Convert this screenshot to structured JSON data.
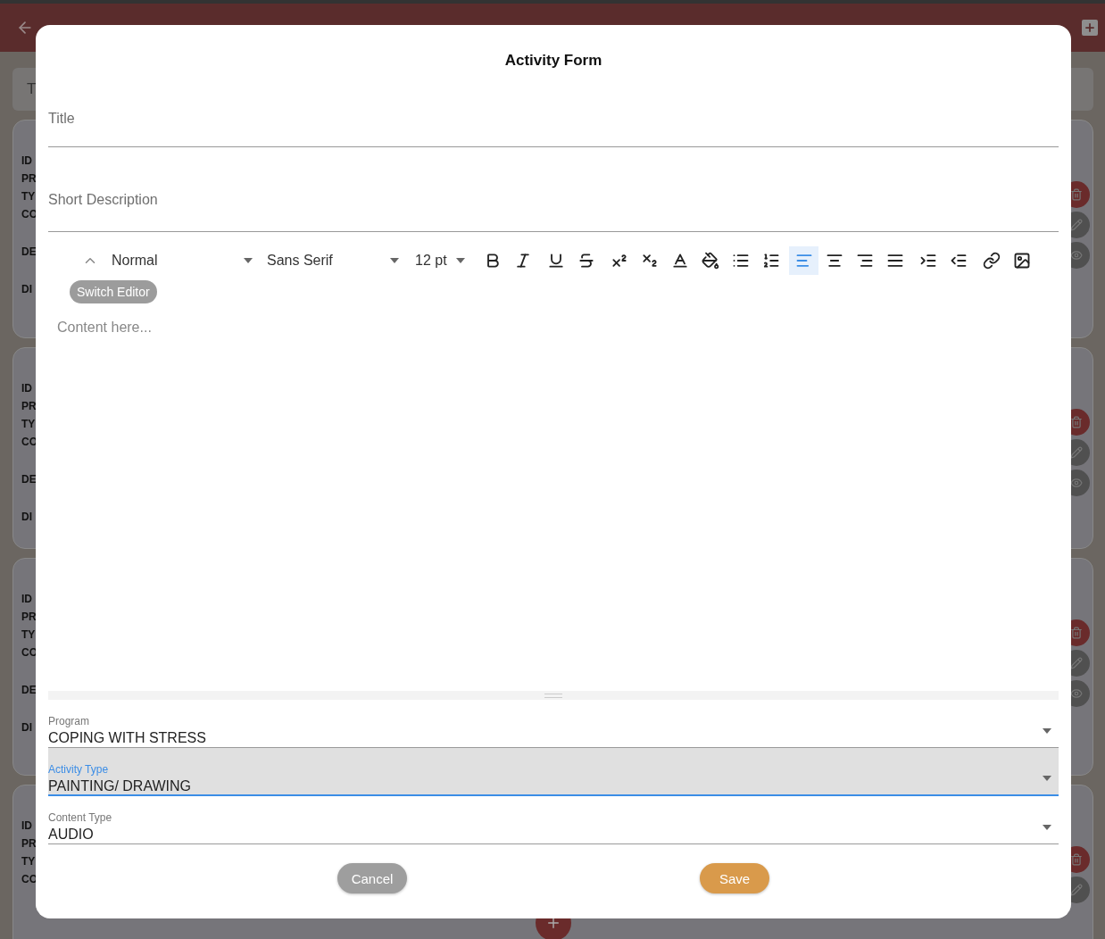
{
  "search": {
    "placeholder": "T"
  },
  "cards": [
    {
      "labels": [
        "ID",
        "PR",
        "TY",
        "CO",
        "DE",
        "DI"
      ],
      "actions": [
        {
          "kind": "delete"
        },
        {
          "kind": "edit"
        },
        {
          "kind": "view"
        }
      ]
    },
    {
      "labels": [
        "ID",
        "PR",
        "TY",
        "CO",
        "DE",
        "DI"
      ],
      "actions": [
        {
          "kind": "delete"
        },
        {
          "kind": "edit"
        },
        {
          "kind": "view"
        }
      ]
    },
    {
      "labels": [
        "ID",
        "PR",
        "TY",
        "CO",
        "DE",
        "DI"
      ],
      "actions": [
        {
          "kind": "delete"
        },
        {
          "kind": "edit"
        },
        {
          "kind": "view"
        }
      ]
    },
    {
      "labels": [
        "ID",
        "PR",
        "TY",
        "CO"
      ],
      "actions": [
        {
          "kind": "delete"
        },
        {
          "kind": "edit"
        }
      ]
    }
  ],
  "dialog": {
    "title": "Activity Form",
    "fields": [
      {
        "placeholder": "Title"
      },
      {
        "placeholder": "Short Description"
      }
    ],
    "editor": {
      "block_format": "Normal",
      "font": "Sans Serif",
      "size": "12 pt",
      "switch_label": "Switch Editor",
      "placeholder": "Content here...",
      "tools": [
        {
          "kind": "bold",
          "selected": false
        },
        {
          "kind": "italic",
          "selected": false
        },
        {
          "kind": "underline",
          "selected": false
        },
        {
          "kind": "strike",
          "selected": false
        },
        {
          "kind": "superscript",
          "selected": false
        },
        {
          "kind": "subscript",
          "selected": false
        },
        {
          "kind": "color",
          "selected": false
        },
        {
          "kind": "background",
          "selected": false
        },
        {
          "kind": "bullet",
          "selected": false
        },
        {
          "kind": "ordered",
          "selected": false
        },
        {
          "kind": "align-left",
          "selected": true
        },
        {
          "kind": "align-center",
          "selected": false
        },
        {
          "kind": "align-right",
          "selected": false
        },
        {
          "kind": "justify",
          "selected": false
        },
        {
          "kind": "indent",
          "selected": false
        },
        {
          "kind": "outdent",
          "selected": false
        },
        {
          "kind": "link",
          "selected": false
        },
        {
          "kind": "image",
          "selected": false
        }
      ]
    },
    "selects": [
      {
        "label": "Program",
        "value": "COPING WITH STRESS",
        "focused": false
      },
      {
        "label": "Activity Type",
        "value": "PAINTING/ DRAWING",
        "focused": true
      },
      {
        "label": "Content Type",
        "value": "AUDIO",
        "focused": false
      }
    ],
    "buttons": [
      {
        "kind": "cancel",
        "label": "Cancel"
      },
      {
        "kind": "save",
        "label": "Save"
      }
    ]
  }
}
